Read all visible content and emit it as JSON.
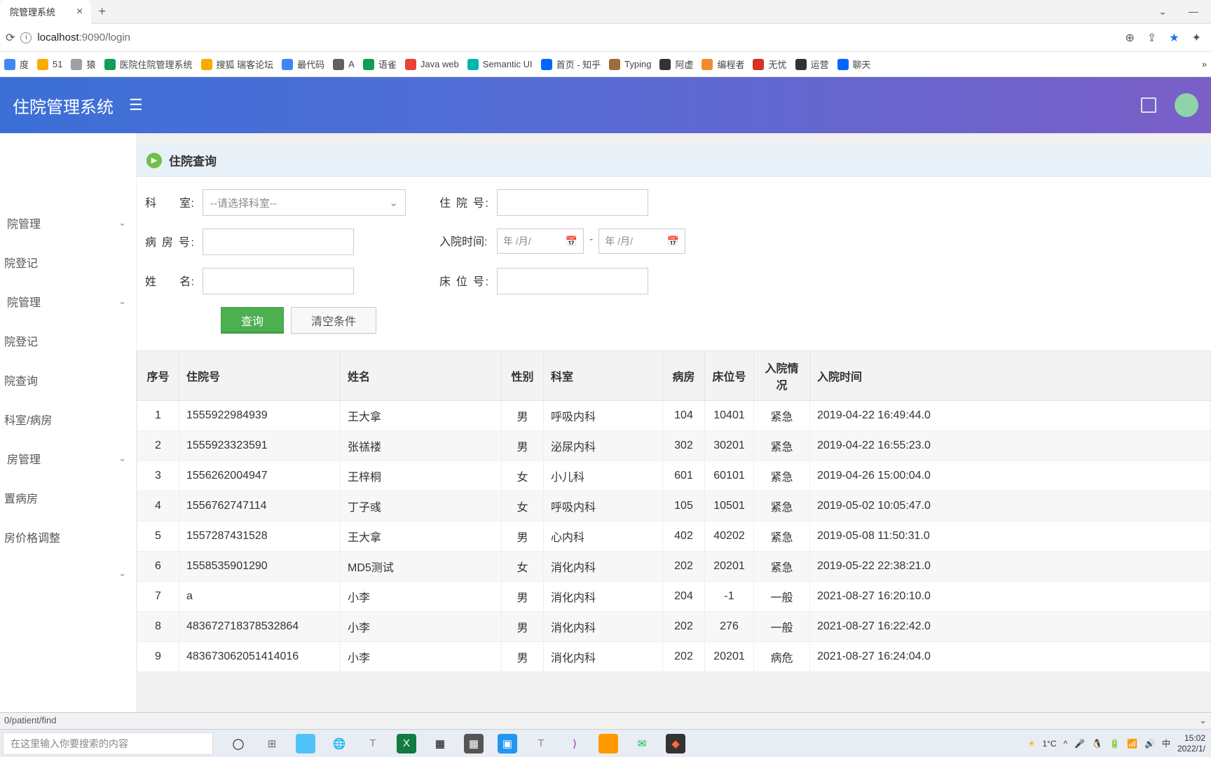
{
  "browser": {
    "tab_title": "院管理系统",
    "url_host": "localhost",
    "url_port": ":9090",
    "url_path": "/login",
    "window_chev": "⌄",
    "window_min": "—"
  },
  "bookmarks": [
    {
      "label": "度",
      "bg": "#4285f4"
    },
    {
      "label": "51",
      "bg": "#f9ab00"
    },
    {
      "label": "猿",
      "bg": "#9aa0a6"
    },
    {
      "label": "医院住院管理系统",
      "bg": "#0f9d58"
    },
    {
      "label": "搜狐 瑞客论坛",
      "bg": "#f9ab00"
    },
    {
      "label": "最代码",
      "bg": "#4285f4"
    },
    {
      "label": "A",
      "bg": "#616161"
    },
    {
      "label": "语雀",
      "bg": "#0f9d58"
    },
    {
      "label": "Java web",
      "bg": "#ea4335"
    },
    {
      "label": "Semantic UI",
      "bg": "#00b5ad"
    },
    {
      "label": "首页 - 知乎",
      "bg": "#0066ff"
    },
    {
      "label": "Typing",
      "bg": "#9e6b3a"
    },
    {
      "label": "阿虚",
      "bg": "#333"
    },
    {
      "label": "编程者",
      "bg": "#f28b2b"
    },
    {
      "label": "无忧",
      "bg": "#d93025"
    },
    {
      "label": "运营",
      "bg": "#333"
    },
    {
      "label": "聊天",
      "bg": "#0066ff"
    }
  ],
  "app": {
    "title": "住院管理系统"
  },
  "sidebar": {
    "items": [
      {
        "label": "院管理",
        "expand": true
      },
      {
        "label": "院登记",
        "sub": true
      },
      {
        "label": "院管理",
        "expand": true
      },
      {
        "label": "院登记",
        "sub": true
      },
      {
        "label": "院查询",
        "sub": true
      },
      {
        "label": "科室/病房",
        "sub": true
      },
      {
        "label": "房管理",
        "expand": true
      },
      {
        "label": "置病房",
        "sub": true
      },
      {
        "label": "房价格调整",
        "sub": true
      },
      {
        "label": "",
        "expand": true
      }
    ]
  },
  "panel": {
    "title": "住院查询"
  },
  "form": {
    "dept_label": "科　　室:",
    "dept_placeholder": "--请选择科室--",
    "admission_no_label": "住 院 号:",
    "ward_no_label": "病 房 号:",
    "admission_time_label": "入院时间:",
    "date_placeholder": "年 /月/",
    "date_sep": "-",
    "name_label": "姓　　名:",
    "bed_no_label": "床 位 号:",
    "search_btn": "查询",
    "clear_btn": "清空条件"
  },
  "table": {
    "headers": [
      "序号",
      "住院号",
      "姓名",
      "性别",
      "科室",
      "病房",
      "床位号",
      "入院情况",
      "入院时间"
    ],
    "rows": [
      [
        "1",
        "1555922984939",
        "王大拿",
        "男",
        "呼吸内科",
        "104",
        "10401",
        "紧急",
        "2019-04-22 16:49:44.0"
      ],
      [
        "2",
        "1555923323591",
        "张禚褛",
        "男",
        "泌尿内科",
        "302",
        "30201",
        "紧急",
        "2019-04-22 16:55:23.0"
      ],
      [
        "3",
        "1556262004947",
        "王梓桐",
        "女",
        "小儿科",
        "601",
        "60101",
        "紧急",
        "2019-04-26 15:00:04.0"
      ],
      [
        "4",
        "1556762747114",
        "丁子彧",
        "女",
        "呼吸内科",
        "105",
        "10501",
        "紧急",
        "2019-05-02 10:05:47.0"
      ],
      [
        "5",
        "1557287431528",
        "王大拿",
        "男",
        "心内科",
        "402",
        "40202",
        "紧急",
        "2019-05-08 11:50:31.0"
      ],
      [
        "6",
        "1558535901290",
        "MD5测试",
        "女",
        "消化内科",
        "202",
        "20201",
        "紧急",
        "2019-05-22 22:38:21.0"
      ],
      [
        "7",
        "a",
        "小李",
        "男",
        "消化内科",
        "204",
        "-1",
        "一般",
        "2021-08-27 16:20:10.0"
      ],
      [
        "8",
        "483672718378532864",
        "小李",
        "男",
        "消化内科",
        "202",
        "276",
        "一般",
        "2021-08-27 16:22:42.0"
      ],
      [
        "9",
        "483673062051414016",
        "小李",
        "男",
        "消化内科",
        "202",
        "20201",
        "病危",
        "2021-08-27 16:24:04.0"
      ]
    ]
  },
  "status_bar": {
    "text": "0/patient/find"
  },
  "taskbar": {
    "search_placeholder": "在这里输入你要搜索的内容",
    "weather": "1°C",
    "ime": "中",
    "time": "15:02",
    "date": "2022/1/"
  }
}
